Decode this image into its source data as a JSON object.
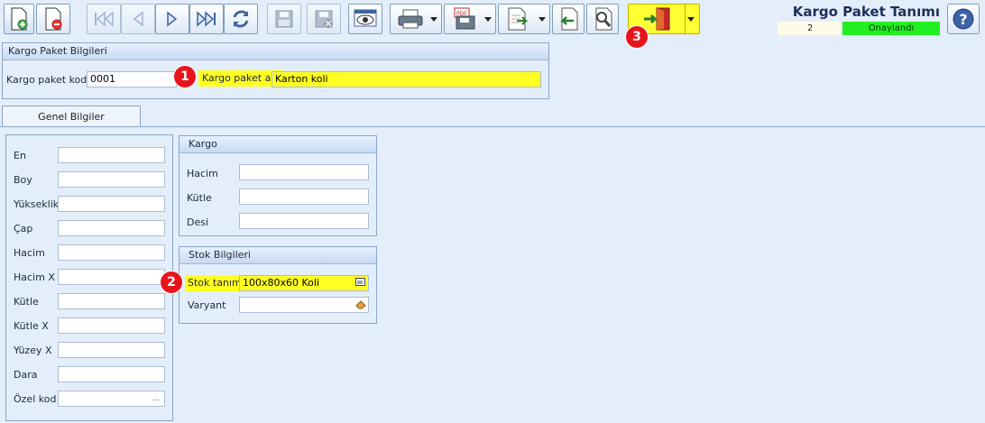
{
  "toolbar": {
    "buttons": [
      {
        "name": "new-record-button",
        "icon": "new-document-icon"
      },
      {
        "name": "delete-record-button",
        "icon": "delete-document-icon"
      },
      {
        "name": "first-record-button",
        "icon": "first-icon"
      },
      {
        "name": "previous-record-button",
        "icon": "previous-icon"
      },
      {
        "name": "next-record-button",
        "icon": "next-icon"
      },
      {
        "name": "last-record-button",
        "icon": "last-icon"
      },
      {
        "name": "refresh-button",
        "icon": "refresh-icon"
      },
      {
        "name": "save-button",
        "icon": "save-icon"
      },
      {
        "name": "cancel-save-button",
        "icon": "save-cancel-icon"
      },
      {
        "name": "preview-button",
        "icon": "eye-icon"
      },
      {
        "name": "print-button",
        "icon": "printer-icon"
      },
      {
        "name": "pdf-export-button",
        "icon": "pdf-icon"
      },
      {
        "name": "export-button",
        "icon": "export-icon"
      },
      {
        "name": "back-button",
        "icon": "back-arrow-icon"
      },
      {
        "name": "search-button",
        "icon": "search-icon"
      },
      {
        "name": "exit-button",
        "icon": "exit-door-icon"
      }
    ]
  },
  "header": {
    "title": "Kargo Paket Tanımı",
    "status_number": "2",
    "status_text": "Onaylandı",
    "status_color": "#22ee22"
  },
  "package_info": {
    "title": "Kargo Paket Bilgileri",
    "code_label": "Kargo paket kodu",
    "code_value": "0001",
    "name_label": "Kargo paket adı",
    "name_value": "Karton koli"
  },
  "tabs": {
    "general": "Genel Bilgiler"
  },
  "dimensions": {
    "fields": [
      {
        "label": "En",
        "value": ""
      },
      {
        "label": "Boy",
        "value": ""
      },
      {
        "label": "Yükseklik",
        "value": ""
      },
      {
        "label": "Çap",
        "value": ""
      },
      {
        "label": "Hacim",
        "value": ""
      },
      {
        "label": "Hacim X",
        "value": ""
      },
      {
        "label": "Kütle",
        "value": ""
      },
      {
        "label": "Kütle X",
        "value": ""
      },
      {
        "label": "Yüzey X",
        "value": ""
      },
      {
        "label": "Dara",
        "value": ""
      },
      {
        "label": "Özel kod",
        "value": ""
      }
    ],
    "ellipsis": "..."
  },
  "kargo": {
    "title": "Kargo",
    "fields": [
      {
        "label": "Hacim",
        "value": ""
      },
      {
        "label": "Kütle",
        "value": ""
      },
      {
        "label": "Desi",
        "value": ""
      }
    ]
  },
  "stock": {
    "title": "Stok Bilgileri",
    "stock_label": "Stok tanımı",
    "stock_value": "100x80x60 Koli",
    "variant_label": "Varyant",
    "variant_value": ""
  },
  "callouts": [
    "1",
    "2",
    "3"
  ],
  "colors": {
    "highlight": "#ffff22",
    "callout": "#e8141c",
    "exit_button": "#ffff33"
  }
}
